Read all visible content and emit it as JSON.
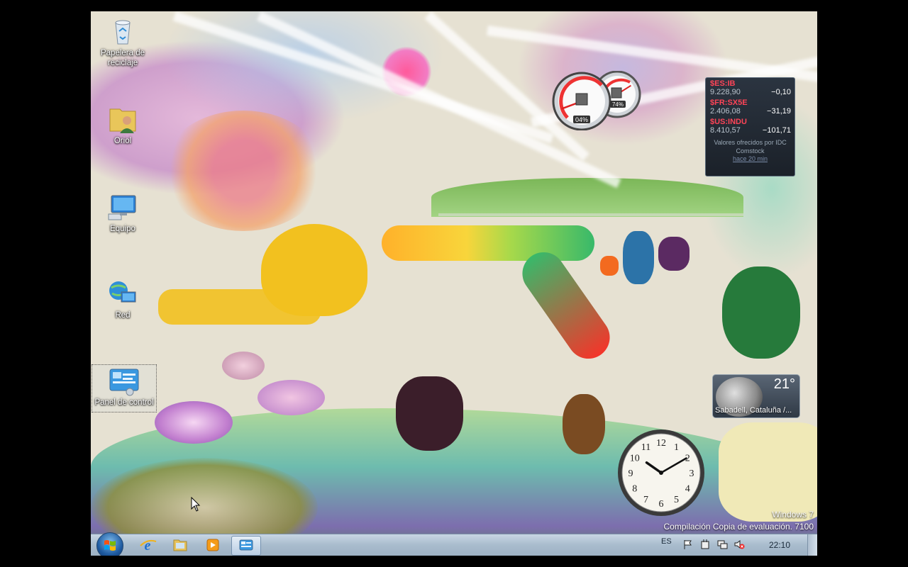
{
  "desktop_icons": [
    {
      "name": "recycle-bin",
      "label": "Papelera de reciclaje"
    },
    {
      "name": "user-folder",
      "label": "Oriol"
    },
    {
      "name": "computer",
      "label": "Equipo"
    },
    {
      "name": "network",
      "label": "Red"
    },
    {
      "name": "control-panel",
      "label": "Panel de control"
    }
  ],
  "stocks": {
    "items": [
      {
        "symbol": "$ES:IB",
        "value": "9.228,90",
        "change": "−0,10"
      },
      {
        "symbol": "$FR:SX5E",
        "value": "2.406,08",
        "change": "−31,19"
      },
      {
        "symbol": "$US:INDU",
        "value": "8.410,57",
        "change": "−101,71"
      }
    ],
    "footer": "Valores ofrecidos por IDC Comstock",
    "updated": "hace 20 min"
  },
  "cpu_meter": {
    "cpu_label": "04%",
    "memory_label": "74%",
    "cpu_percent": 4,
    "memory_percent": 74
  },
  "weather": {
    "temperature": "21°",
    "location": "Sabadell, Cataluña /..."
  },
  "clock": {
    "hour": 10,
    "minute": 10,
    "numerals": [
      "12",
      "1",
      "2",
      "3",
      "4",
      "5",
      "6",
      "7",
      "8",
      "9",
      "10",
      "11"
    ]
  },
  "watermark": {
    "line1": "Windows 7",
    "line2": "Compilación Copia de evaluación. 7100"
  },
  "taskbar": {
    "pinned": [
      "internet-explorer",
      "windows-explorer",
      "media-player",
      "control-panel"
    ],
    "language": "ES",
    "time": "22:10"
  }
}
